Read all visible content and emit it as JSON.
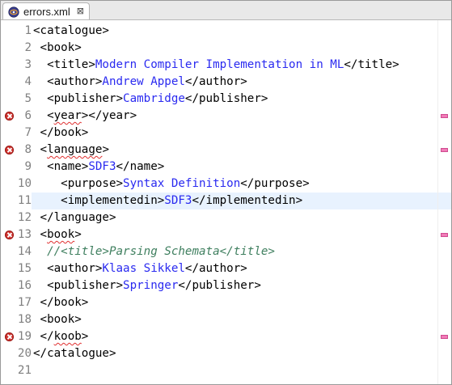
{
  "tab": {
    "title": "errors.xml",
    "close_glyph": "⊠",
    "icon": "xml-file-icon"
  },
  "colors": {
    "text": "#000000",
    "value": "#2a2af0",
    "comment": "#3f7f5f",
    "line_number": "#808080",
    "current_line": "#e8f2fe",
    "error": "#d0312d",
    "overview_marker": "#f17cb7"
  },
  "current_line": 11,
  "lines": [
    {
      "n": "1",
      "error": false,
      "segments": [
        {
          "t": "<catalogue>",
          "k": "tag"
        }
      ]
    },
    {
      "n": "2",
      "error": false,
      "segments": [
        {
          "t": " <book>",
          "k": "tag"
        }
      ]
    },
    {
      "n": "3",
      "error": false,
      "segments": [
        {
          "t": "  <title>",
          "k": "tag"
        },
        {
          "t": "Modern Compiler Implementation in ML",
          "k": "value"
        },
        {
          "t": "</title>",
          "k": "tag"
        }
      ]
    },
    {
      "n": "4",
      "error": false,
      "segments": [
        {
          "t": "  <author>",
          "k": "tag"
        },
        {
          "t": "Andrew Appel",
          "k": "value"
        },
        {
          "t": "</author>",
          "k": "tag"
        }
      ]
    },
    {
      "n": "5",
      "error": false,
      "segments": [
        {
          "t": "  <publisher>",
          "k": "tag"
        },
        {
          "t": "Cambridge",
          "k": "value"
        },
        {
          "t": "</publisher>",
          "k": "tag"
        }
      ]
    },
    {
      "n": "6",
      "error": true,
      "segments": [
        {
          "t": "  <",
          "k": "tag"
        },
        {
          "t": "year",
          "k": "error"
        },
        {
          "t": "></year>",
          "k": "tag"
        }
      ]
    },
    {
      "n": "7",
      "error": false,
      "segments": [
        {
          "t": " </book>",
          "k": "tag"
        }
      ]
    },
    {
      "n": "8",
      "error": true,
      "segments": [
        {
          "t": " <",
          "k": "tag"
        },
        {
          "t": "language",
          "k": "error"
        },
        {
          "t": ">",
          "k": "tag"
        }
      ]
    },
    {
      "n": "9",
      "error": false,
      "segments": [
        {
          "t": "  <name>",
          "k": "tag"
        },
        {
          "t": "SDF3",
          "k": "value"
        },
        {
          "t": "</name>",
          "k": "tag"
        }
      ]
    },
    {
      "n": "10",
      "error": false,
      "segments": [
        {
          "t": "    <purpose>",
          "k": "tag"
        },
        {
          "t": "Syntax Definition",
          "k": "value"
        },
        {
          "t": "</purpose>",
          "k": "tag"
        }
      ]
    },
    {
      "n": "11",
      "error": false,
      "segments": [
        {
          "t": "    <implementedin>",
          "k": "tag"
        },
        {
          "t": "SDF3",
          "k": "value"
        },
        {
          "t": "</implementedin>",
          "k": "tag"
        }
      ]
    },
    {
      "n": "12",
      "error": false,
      "segments": [
        {
          "t": " </language>",
          "k": "tag"
        }
      ]
    },
    {
      "n": "13",
      "error": true,
      "segments": [
        {
          "t": " <",
          "k": "tag"
        },
        {
          "t": "book",
          "k": "error"
        },
        {
          "t": ">",
          "k": "tag"
        }
      ]
    },
    {
      "n": "14",
      "error": false,
      "segments": [
        {
          "t": "  //<title>Parsing Schemata</title>",
          "k": "comment"
        }
      ]
    },
    {
      "n": "15",
      "error": false,
      "segments": [
        {
          "t": "  <author>",
          "k": "tag"
        },
        {
          "t": "Klaas Sikkel",
          "k": "value"
        },
        {
          "t": "</author>",
          "k": "tag"
        }
      ]
    },
    {
      "n": "16",
      "error": false,
      "segments": [
        {
          "t": "  <publisher>",
          "k": "tag"
        },
        {
          "t": "Springer",
          "k": "value"
        },
        {
          "t": "</publisher>",
          "k": "tag"
        }
      ]
    },
    {
      "n": "17",
      "error": false,
      "segments": [
        {
          "t": " </book>",
          "k": "tag"
        }
      ]
    },
    {
      "n": "18",
      "error": false,
      "segments": [
        {
          "t": " <book>",
          "k": "tag"
        }
      ]
    },
    {
      "n": "19",
      "error": true,
      "segments": [
        {
          "t": " </",
          "k": "tag"
        },
        {
          "t": "koob",
          "k": "error"
        },
        {
          "t": ">",
          "k": "tag"
        }
      ]
    },
    {
      "n": "20",
      "error": false,
      "segments": [
        {
          "t": "</catalogue>",
          "k": "tag"
        }
      ]
    },
    {
      "n": "21",
      "error": false,
      "segments": []
    }
  ]
}
